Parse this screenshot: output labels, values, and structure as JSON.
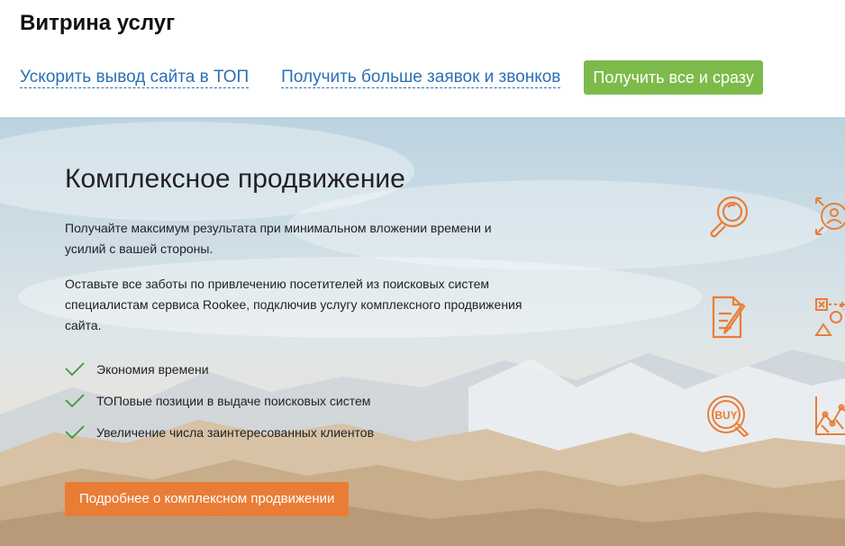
{
  "page": {
    "title": "Витрина услуг"
  },
  "tabs": [
    {
      "label": "Ускорить вывод сайта в ТОП"
    },
    {
      "label": "Получить больше заявок и звонков"
    },
    {
      "label": "Получить все и сразу",
      "active": true
    }
  ],
  "hero": {
    "title": "Комплексное продвижение",
    "paragraph1": "Получайте максимум результата при минимальном вложении времени и усилий с вашей стороны.",
    "paragraph2": "Оставьте все заботы по привлечению посетителей из поисковых систем специалистам сервиса Rookee, подключив услугу комплексного продвижения сайта.",
    "features": [
      "Экономия времени",
      "ТОПовые позиции в выдаче поисковых систем",
      "Увеличение числа заинтересованных клиентов"
    ],
    "cta_label": "Подробнее о комплексном продвижении",
    "buy_text": "BUY"
  },
  "colors": {
    "accent_orange": "#ea7d36",
    "accent_green": "#7cbb4a",
    "link_blue": "#2a6fb8",
    "check_green": "#3a9a3a"
  },
  "icons": [
    "magnifier-icon",
    "target-audience-icon",
    "document-edit-icon",
    "strategy-icon",
    "buy-icon",
    "growth-chart-icon",
    "check-icon"
  ]
}
